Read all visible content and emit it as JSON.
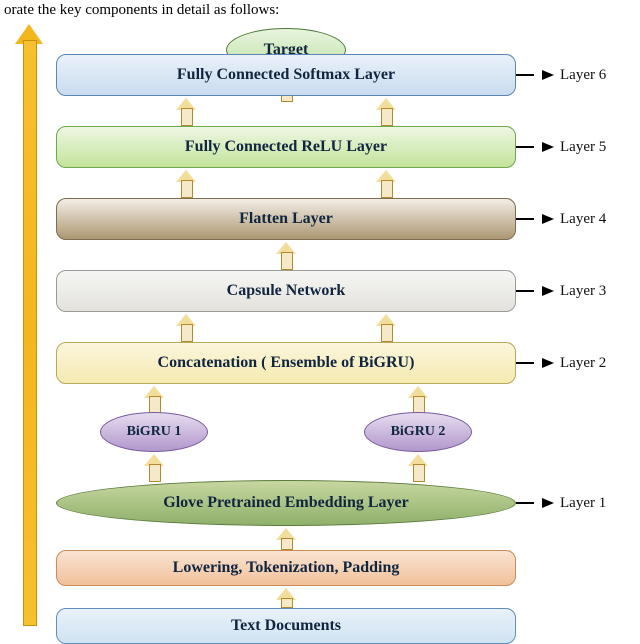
{
  "caption": "orate the key components in detail as follows:",
  "target": {
    "label": "Target"
  },
  "layers": {
    "l6": {
      "box": "Fully Connected  Softmax Layer",
      "label": "Layer 6"
    },
    "l5": {
      "box": "Fully Connected ReLU Layer",
      "label": "Layer 5"
    },
    "l4": {
      "box": "Flatten Layer",
      "label": "Layer 4"
    },
    "l3": {
      "box": "Capsule Network",
      "label": "Layer 3"
    },
    "l2": {
      "box": "Concatenation ( Ensemble of  BiGRU)",
      "label": "Layer 2"
    },
    "l1": {
      "box": "Glove Pretrained Embedding Layer",
      "label": "Layer 1"
    }
  },
  "bigru": {
    "b1": "BiGRU 1",
    "b2": "BiGRU 2"
  },
  "preproc": {
    "box": "Lowering, Tokenization, Padding"
  },
  "input": {
    "box": "Text Documents"
  },
  "chart_data": {
    "type": "diagram",
    "flow": [
      "Text Documents",
      "Lowering, Tokenization, Padding",
      "Glove Pretrained Embedding Layer",
      [
        "BiGRU 1",
        "BiGRU 2"
      ],
      "Concatenation ( Ensemble of BiGRU)",
      "Capsule Network",
      "Flatten Layer",
      "Fully Connected ReLU Layer",
      "Fully Connected Softmax Layer",
      "Target"
    ],
    "layer_numbers": {
      "Glove Pretrained Embedding Layer": 1,
      "Concatenation ( Ensemble of BiGRU)": 2,
      "Capsule Network": 3,
      "Flatten Layer": 4,
      "Fully Connected ReLU Layer": 5,
      "Fully Connected Softmax Layer": 6
    }
  }
}
